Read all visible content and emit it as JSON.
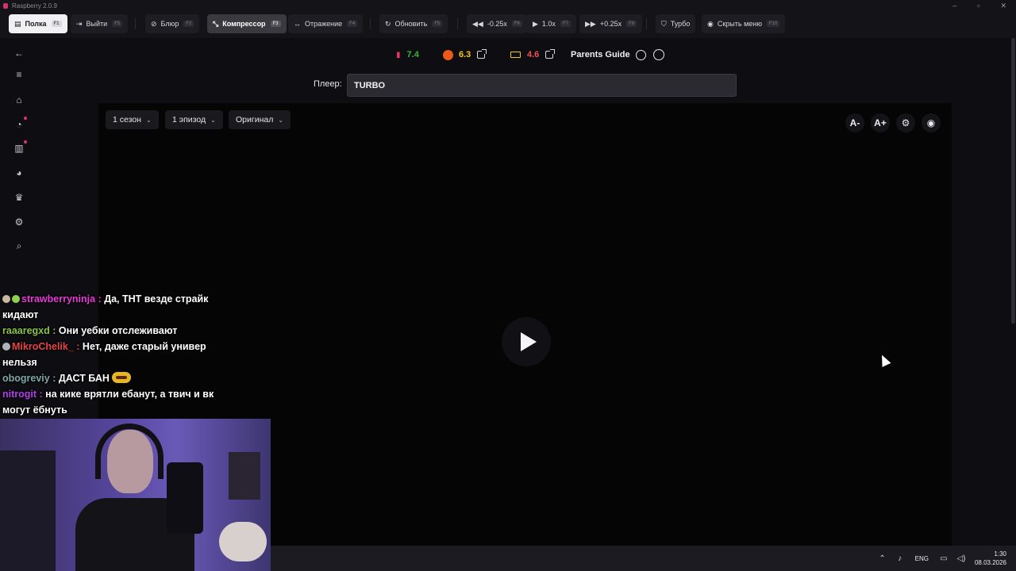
{
  "window": {
    "title": "Raspberry 2.0.9"
  },
  "toolbar": {
    "buttons": [
      {
        "label": "Полка",
        "key": "F1",
        "icon": "book-icon"
      },
      {
        "label": "Выйти",
        "key": "F5",
        "icon": "exit-icon"
      },
      {
        "label": "Блюр",
        "key": "F2",
        "icon": "eye-off-icon"
      },
      {
        "label": "Компрессор",
        "key": "F3",
        "icon": "compress-icon"
      },
      {
        "label": "Отражение",
        "key": "F4",
        "icon": "mirror-icon"
      },
      {
        "label": "Обновить",
        "key": "F5",
        "icon": "refresh-icon"
      },
      {
        "label": "-0.25x",
        "key": "F6",
        "icon": "rewind-icon"
      },
      {
        "label": "1.0x",
        "key": "F7",
        "icon": "play-icon"
      },
      {
        "label": "+0.25x",
        "key": "F8",
        "icon": "fast-forward-icon"
      },
      {
        "label": "Турбо",
        "icon": "shield-icon"
      },
      {
        "label": "Скрыть меню",
        "key": "F10",
        "icon": "eye-icon"
      }
    ]
  },
  "sidebar": {
    "items": [
      {
        "name": "back",
        "icon": "arrow-left-icon"
      },
      {
        "name": "menu",
        "icon": "hamburger-icon"
      },
      {
        "name": "home",
        "icon": "home-icon"
      },
      {
        "name": "history",
        "icon": "history-icon",
        "dot": true
      },
      {
        "name": "library",
        "icon": "book-icon",
        "dot": true
      },
      {
        "name": "compass",
        "icon": "compass-icon"
      },
      {
        "name": "trophy",
        "icon": "trophy-icon"
      },
      {
        "name": "settings",
        "icon": "gear-icon"
      },
      {
        "name": "search",
        "icon": "search-icon"
      }
    ]
  },
  "ratings": {
    "kp": {
      "value": "7.4",
      "color": "#3bb33b"
    },
    "shikimori": {
      "value": "6.3",
      "color": "#f5c518"
    },
    "imdb": {
      "value": "4.6",
      "color": "#f25252"
    },
    "parents_guide": "Parents Guide"
  },
  "player": {
    "label": "Плеер:",
    "value": "TURBO"
  },
  "video": {
    "season": "1 сезон",
    "episode": "1 эпизод",
    "audio": "Оригинал",
    "font_smaller": "A-",
    "font_larger": "A+"
  },
  "chat": {
    "messages": [
      {
        "user": "strawberryninja",
        "color": "#e83ad6",
        "text": "Да, ТНТ везде страйк кидают",
        "badges": 2
      },
      {
        "user": "raaaregxd",
        "color": "#8bc34a",
        "text": "Они уебки отслеживают",
        "badges": 0
      },
      {
        "user": "MikroChelik_",
        "color": "#e64545",
        "text": "Нет, даже старый универ нельзя",
        "badges": 1
      },
      {
        "user": "obogreviy",
        "color": "#7fa8a8",
        "text": "ДАСТ БАН",
        "badges": 0,
        "emote": true
      },
      {
        "user": "nitrogit",
        "color": "#b040e8",
        "text": "на кике врятли ебанут, а твич и вк могут ёбнуть",
        "badges": 0
      }
    ]
  },
  "taskbar": {
    "lang": "ENG",
    "time": "1:30",
    "date": "08.03.2026"
  }
}
